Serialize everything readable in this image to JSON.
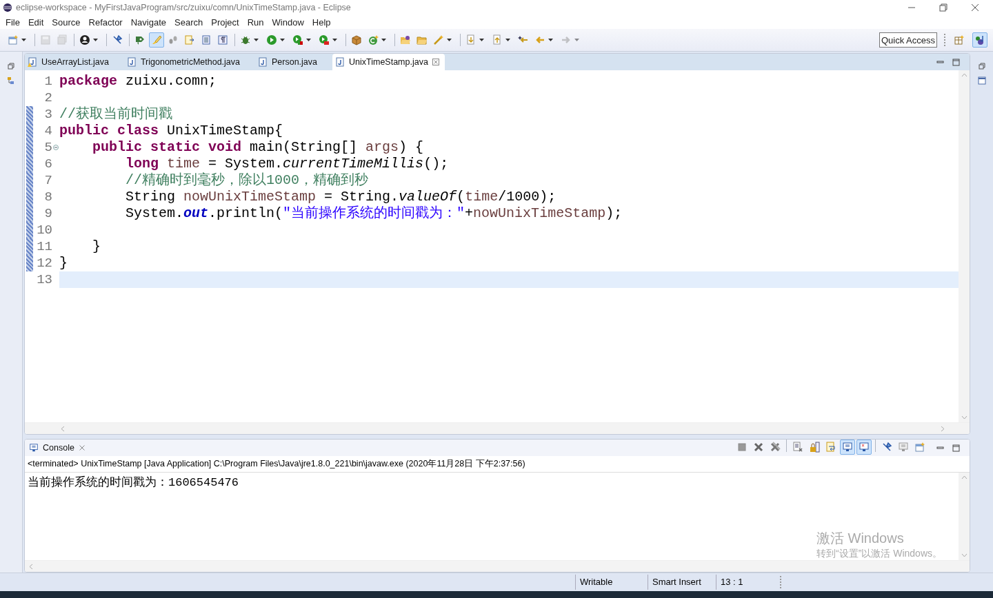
{
  "window": {
    "title": "eclipse-workspace - MyFirstJavaProgram/src/zuixu/comn/UnixTimeStamp.java - Eclipse"
  },
  "menu": [
    "File",
    "Edit",
    "Source",
    "Refactor",
    "Navigate",
    "Search",
    "Project",
    "Run",
    "Window",
    "Help"
  ],
  "toolbar": [
    [
      {
        "kind": "new",
        "dropdown": true,
        "pressed": false,
        "disabled": false
      }
    ],
    [
      {
        "kind": "save",
        "dropdown": false,
        "pressed": false,
        "disabled": true
      },
      {
        "kind": "save-all",
        "dropdown": false,
        "pressed": false,
        "disabled": true
      }
    ],
    [
      {
        "kind": "profile",
        "dropdown": true,
        "pressed": false,
        "disabled": false
      }
    ],
    [
      {
        "kind": "pin",
        "dropdown": false,
        "pressed": false,
        "disabled": false
      }
    ],
    [
      {
        "kind": "tag",
        "dropdown": false,
        "pressed": false,
        "disabled": false
      },
      {
        "kind": "brush",
        "dropdown": false,
        "pressed": true,
        "disabled": false
      },
      {
        "kind": "steps",
        "dropdown": false,
        "pressed": false,
        "disabled": false
      },
      {
        "kind": "doc",
        "dropdown": false,
        "pressed": false,
        "disabled": false
      },
      {
        "kind": "block",
        "dropdown": false,
        "pressed": false,
        "disabled": false
      },
      {
        "kind": "pilcrow",
        "dropdown": false,
        "pressed": false,
        "disabled": false
      }
    ],
    [
      {
        "kind": "bug",
        "dropdown": true,
        "pressed": false,
        "disabled": false
      },
      {
        "kind": "run",
        "dropdown": true,
        "pressed": false,
        "disabled": false
      },
      {
        "kind": "coverage",
        "dropdown": true,
        "pressed": false,
        "disabled": false
      },
      {
        "kind": "external",
        "dropdown": true,
        "pressed": false,
        "disabled": false
      }
    ],
    [
      {
        "kind": "package",
        "dropdown": false,
        "pressed": false,
        "disabled": false
      },
      {
        "kind": "class",
        "dropdown": true,
        "pressed": false,
        "disabled": false
      }
    ],
    [
      {
        "kind": "open-folder",
        "dropdown": false,
        "pressed": false,
        "disabled": false
      },
      {
        "kind": "folder",
        "dropdown": false,
        "pressed": false,
        "disabled": false
      },
      {
        "kind": "wand",
        "dropdown": true,
        "pressed": false,
        "disabled": false
      }
    ],
    [
      {
        "kind": "down",
        "dropdown": true,
        "pressed": false,
        "disabled": false
      },
      {
        "kind": "up",
        "dropdown": true,
        "pressed": false,
        "disabled": false
      },
      {
        "kind": "last-edit",
        "dropdown": false,
        "pressed": false,
        "disabled": false
      },
      {
        "kind": "back",
        "dropdown": true,
        "pressed": false,
        "disabled": false
      },
      {
        "kind": "forward",
        "dropdown": true,
        "pressed": false,
        "disabled": true
      }
    ]
  ],
  "quick_access": {
    "placeholder": "Quick Access"
  },
  "perspectives": [
    {
      "kind": "open",
      "selected": false
    },
    {
      "kind": "java",
      "selected": true
    }
  ],
  "tabs": [
    {
      "label": "UseArrayList.java",
      "selected": false,
      "warning": true
    },
    {
      "label": "TrigonometricMethod.java",
      "selected": false,
      "warning": false
    },
    {
      "label": "Person.java",
      "selected": false,
      "warning": false
    },
    {
      "label": "UnixTimeStamp.java",
      "selected": true,
      "warning": false
    }
  ],
  "editor": {
    "lines": [
      {
        "n": "1",
        "changed": false,
        "fold": false,
        "current": false,
        "tokens": [
          {
            "kind": "keyword",
            "t": "package"
          },
          {
            "kind": "plain",
            "t": " zuixu.comn;"
          }
        ]
      },
      {
        "n": "2",
        "changed": false,
        "fold": false,
        "current": false
      },
      {
        "n": "3",
        "changed": true,
        "fold": false,
        "current": false,
        "tokens": [
          {
            "kind": "comment",
            "t": "//获取当前时间戳"
          }
        ]
      },
      {
        "n": "4",
        "changed": true,
        "fold": false,
        "current": false,
        "tokens": [
          {
            "kind": "keyword",
            "t": "public class"
          },
          {
            "kind": "plain",
            "t": " UnixTimeStamp{"
          }
        ]
      },
      {
        "n": "5",
        "changed": true,
        "fold": true,
        "current": false,
        "tokens": [
          {
            "kind": "keyword",
            "t": "    public static void"
          },
          {
            "kind": "plain",
            "t": " main(String[] "
          },
          {
            "kind": "variable",
            "t": "args"
          },
          {
            "kind": "plain",
            "t": ") {"
          }
        ]
      },
      {
        "n": "6",
        "changed": true,
        "fold": false,
        "current": false,
        "tokens": [
          {
            "kind": "keyword",
            "t": "        long"
          },
          {
            "kind": "variable",
            "t": " time"
          },
          {
            "kind": "plain",
            "t": " = System."
          },
          {
            "kind": "static-method",
            "t": "currentTimeMillis"
          },
          {
            "kind": "plain",
            "t": "();"
          }
        ]
      },
      {
        "n": "7",
        "changed": true,
        "fold": false,
        "current": false,
        "tokens": [
          {
            "kind": "comment",
            "t": "        //精确时到毫秒，除以1000，精确到秒"
          }
        ]
      },
      {
        "n": "8",
        "changed": true,
        "fold": false,
        "current": false,
        "tokens": [
          {
            "kind": "plain",
            "t": "        String "
          },
          {
            "kind": "variable",
            "t": "nowUnixTimeStamp"
          },
          {
            "kind": "plain",
            "t": " = String."
          },
          {
            "kind": "static-method",
            "t": "valueOf"
          },
          {
            "kind": "plain",
            "t": "("
          },
          {
            "kind": "variable",
            "t": "time"
          },
          {
            "kind": "plain",
            "t": "/1000);"
          }
        ]
      },
      {
        "n": "9",
        "changed": true,
        "fold": false,
        "current": false,
        "tokens": [
          {
            "kind": "plain",
            "t": "        System."
          },
          {
            "kind": "static-field",
            "t": "out"
          },
          {
            "kind": "plain",
            "t": ".println("
          },
          {
            "kind": "string",
            "t": "\"当前操作系统的时间戳为：\""
          },
          {
            "kind": "plain",
            "t": "+"
          },
          {
            "kind": "variable",
            "t": "nowUnixTimeStamp"
          },
          {
            "kind": "plain",
            "t": ");"
          }
        ]
      },
      {
        "n": "10",
        "changed": true,
        "fold": false,
        "current": false
      },
      {
        "n": "11",
        "changed": true,
        "fold": false,
        "current": false,
        "tokens": [
          {
            "kind": "plain",
            "t": "    }"
          }
        ]
      },
      {
        "n": "12",
        "changed": true,
        "fold": false,
        "current": false,
        "tokens": [
          {
            "kind": "plain",
            "t": "}"
          }
        ]
      },
      {
        "n": "13",
        "changed": false,
        "fold": false,
        "current": true
      }
    ]
  },
  "console": {
    "title": "Console",
    "toolbar": [
      [
        {
          "kind": "stop",
          "pressed": false
        },
        {
          "kind": "remove",
          "pressed": false
        },
        {
          "kind": "remove-all",
          "pressed": false
        }
      ],
      [
        {
          "kind": "clear",
          "pressed": false
        },
        {
          "kind": "lock",
          "pressed": false
        },
        {
          "kind": "wrap",
          "pressed": false
        },
        {
          "kind": "show-out",
          "pressed": true
        },
        {
          "kind": "show-err",
          "pressed": true
        }
      ],
      [
        {
          "kind": "pin",
          "pressed": false
        },
        {
          "kind": "display",
          "pressed": false
        },
        {
          "kind": "new-console",
          "pressed": false
        }
      ]
    ],
    "description": "<terminated> UnixTimeStamp [Java Application] C:\\Program Files\\Java\\jre1.8.0_221\\bin\\javaw.exe (2020年11月28日 下午2:37:56)",
    "output": [
      "当前操作系统的时间戳为：1606545476"
    ]
  },
  "activation": {
    "title": "激活 Windows",
    "hint": "转到“设置”以激活 Windows。"
  },
  "status_bar": [
    "Writable",
    "Smart Insert",
    "13 : 1"
  ]
}
